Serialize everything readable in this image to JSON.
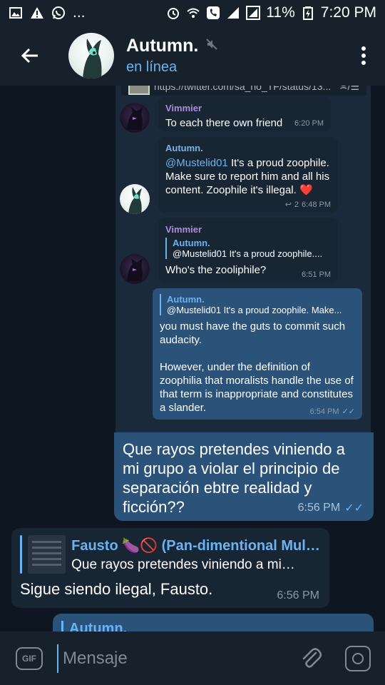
{
  "status_bar": {
    "battery": "11%",
    "time": "7:20 PM",
    "ellipsis": "..."
  },
  "header": {
    "title": "Autumn.",
    "status": "en línea"
  },
  "screenshot": {
    "link_url": "https://twitter.com/sa_no_TF/status/13...",
    "link_tools": "≍/☰",
    "messages": [
      {
        "sender": "Vimmier",
        "text": "To each there own friend",
        "time": "6:20 PM"
      },
      {
        "sender": "Autumn.",
        "mention": "@Mustelid01",
        "text": " It's a proud zoophile. Make sure to report him and all his content. Zoophile it's illegal. ❤️",
        "reply_count": "2",
        "time": "6:48 PM"
      },
      {
        "sender": "Vimmier",
        "quote_name": "Autumn.",
        "quote_text": "@Mustelid01 It's a proud zoophile....",
        "text": "Who's the zooliphile?",
        "time": "6:51 PM"
      },
      {
        "quote_name": "Autumn.",
        "quote_text": "@Mustelid01 It's a proud zoophile. Make...",
        "text1": "you must have the guts to commit such audacity.",
        "text2": "However, under the definition of zoophilia that moralists handle the use of that term is inappropriate and constitutes a slander.",
        "time": "6:54 PM"
      }
    ]
  },
  "messages": [
    {
      "text": "Que rayos pretendes viniendo a mi grupo a violar el principio de separación ebtre realidad y ficción??",
      "time": "6:56 PM"
    },
    {
      "reply_name": "Fausto 🍆🚫 (Pan-dimentional Mult…",
      "reply_text": "Que rayos pretendes viniendo a mi…",
      "text": "Sigue siendo ilegal, Fausto.",
      "time": "6:56 PM"
    },
    {
      "reply_name": "Autumn."
    }
  ],
  "input": {
    "gif_label": "GIF",
    "placeholder": "Mensaje"
  },
  "colors": {
    "bg": "#0e1621",
    "bar": "#17212b",
    "bubble_out": "#2b5278",
    "bubble_in": "#182533",
    "accent": "#6ab3f3"
  }
}
